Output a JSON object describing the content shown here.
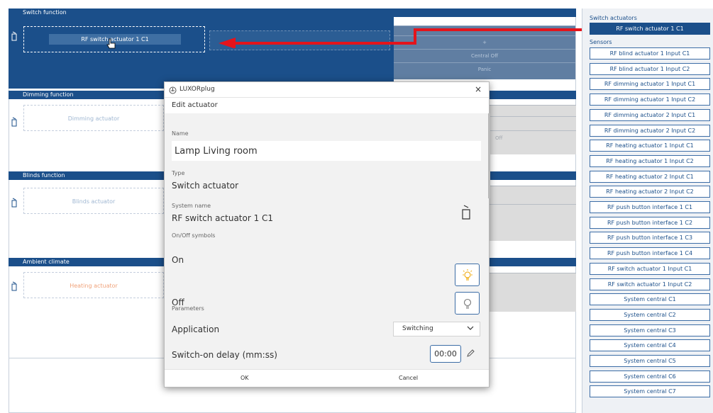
{
  "sections": {
    "switch": {
      "title": "Switch function"
    },
    "dimming": {
      "title": "Dimming function",
      "placeholder": "Dimming actuator"
    },
    "blinds": {
      "title": "Blinds function",
      "placeholder": "Blinds actuator"
    },
    "climate": {
      "title": "Ambient climate",
      "placeholder": "Heating actuator"
    }
  },
  "switch_area": {
    "dragged_device": "RF switch actuator 1 C1",
    "grid_items": [
      "+",
      "Central Off",
      "Panic"
    ]
  },
  "gray_rows": {
    "dimming_off": "Off"
  },
  "sidebar": {
    "switch_header": "Switch actuators",
    "selected_item": "RF switch actuator 1 C1",
    "sensors_header": "Sensors",
    "items": [
      "RF blind actuator 1 Input C1",
      "RF blind actuator 1 Input C2",
      "RF dimming actuator 1 Input C1",
      "RF dimming actuator 1 Input C2",
      "RF dimming actuator 2 Input C1",
      "RF dimming actuator 2 Input C2",
      "RF heating actuator 1 Input C1",
      "RF heating actuator 1 Input C2",
      "RF heating actuator 2 Input C1",
      "RF heating actuator 2 Input C2",
      "RF push button interface 1 C1",
      "RF push button interface 1 C2",
      "RF push button interface 1 C3",
      "RF push button interface 1 C4",
      "RF switch actuator 1 Input C1",
      "RF switch actuator 1 Input C2",
      "System central C1",
      "System central C2",
      "System central C3",
      "System central C4",
      "System central C5",
      "System central C6",
      "System central C7"
    ]
  },
  "dialog": {
    "app_title": "LUXORplug",
    "close": "×",
    "subtitle": "Edit actuator",
    "name_label": "Name",
    "name_value": "Lamp Living room",
    "type_label": "Type",
    "type_value": "Switch actuator",
    "system_name_label": "System name",
    "system_name_value": "RF switch actuator 1 C1",
    "symbols_label": "On/Off symbols",
    "on_label": "On",
    "off_label": "Off",
    "parameters_label": "Parameters",
    "application_label": "Application",
    "application_value": "Switching",
    "delay_label": "Switch-on delay (mm:ss)",
    "delay_value": "00:00",
    "ok": "OK",
    "cancel": "Cancel"
  },
  "colors": {
    "primary": "#1b4f8a",
    "arrow": "#e4141b",
    "lamp_on": "#f2b324"
  },
  "icons": [
    "lamp-icon",
    "luxorplug-logo-icon",
    "close-icon",
    "bulb-on-icon",
    "bulb-off-icon",
    "chevron-down-icon",
    "pencil-icon",
    "hand-cursor-icon"
  ]
}
